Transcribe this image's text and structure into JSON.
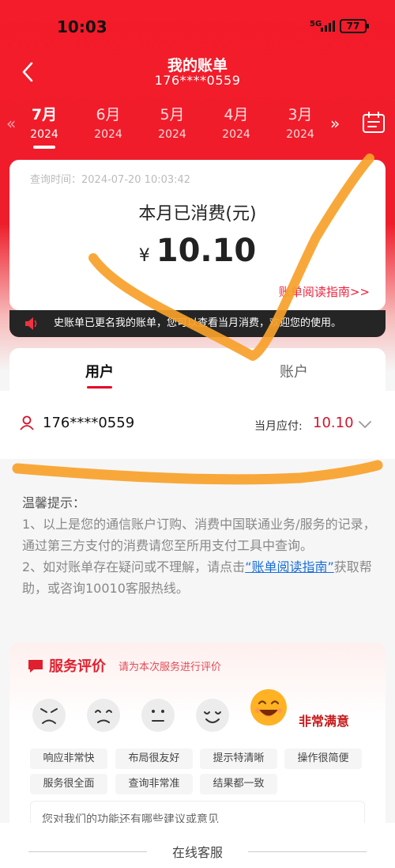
{
  "status_bar": {
    "time": "10:03",
    "network": "5G",
    "battery": "77"
  },
  "header": {
    "title": "我的账单",
    "subtitle": "176****0559"
  },
  "months": [
    {
      "month": "7月",
      "year": "2024",
      "active": true
    },
    {
      "month": "6月",
      "year": "2024",
      "active": false
    },
    {
      "month": "5月",
      "year": "2024",
      "active": false
    },
    {
      "month": "4月",
      "year": "2024",
      "active": false
    },
    {
      "month": "3月",
      "year": "2024",
      "active": false
    }
  ],
  "summary": {
    "query_time": "查询时间：2024-07-20 10:03:42",
    "spent_label": "本月已消费(元)",
    "currency": "¥",
    "amount": "10.10",
    "guide_link": "账单阅读指南>>"
  },
  "notice": "史账单已更名我的账单，您可以查看当月消费，欢迎您的使用。",
  "tabs": {
    "user": "用户",
    "account": "账户"
  },
  "user_row": {
    "phone": "176****0559",
    "due_label": "当月应付:",
    "due_value": "10.10"
  },
  "tips": {
    "head": "温馨提示：",
    "item1": "1、以上是您的通信账户订购、消费中国联通业务/服务的记录，通过第三方支付的消费请您至所用支付工具中查询。",
    "item2_pre": "2、如对账单存在疑问或不理解，请点击",
    "item2_link": "“账单阅读指南”",
    "item2_post": "获取帮助，或咨询10010客服热线。"
  },
  "rating": {
    "title": "服务评价",
    "subtitle": "请为本次服务进行评价",
    "selected_label": "非常满意",
    "chips": [
      "响应非常快",
      "布局很友好",
      "提示特清晰",
      "操作很简便",
      "服务很全面",
      "查询非常准",
      "结果都一致"
    ],
    "suggest_placeholder": "您对我们的功能还有哪些建议或意见"
  },
  "footer": {
    "label": "在线客服"
  },
  "colors": {
    "primary_red": "#ee1d2b",
    "accent_red": "#d2152c",
    "link_blue": "#1a6fd6",
    "scribble_orange": "#f7a129"
  }
}
